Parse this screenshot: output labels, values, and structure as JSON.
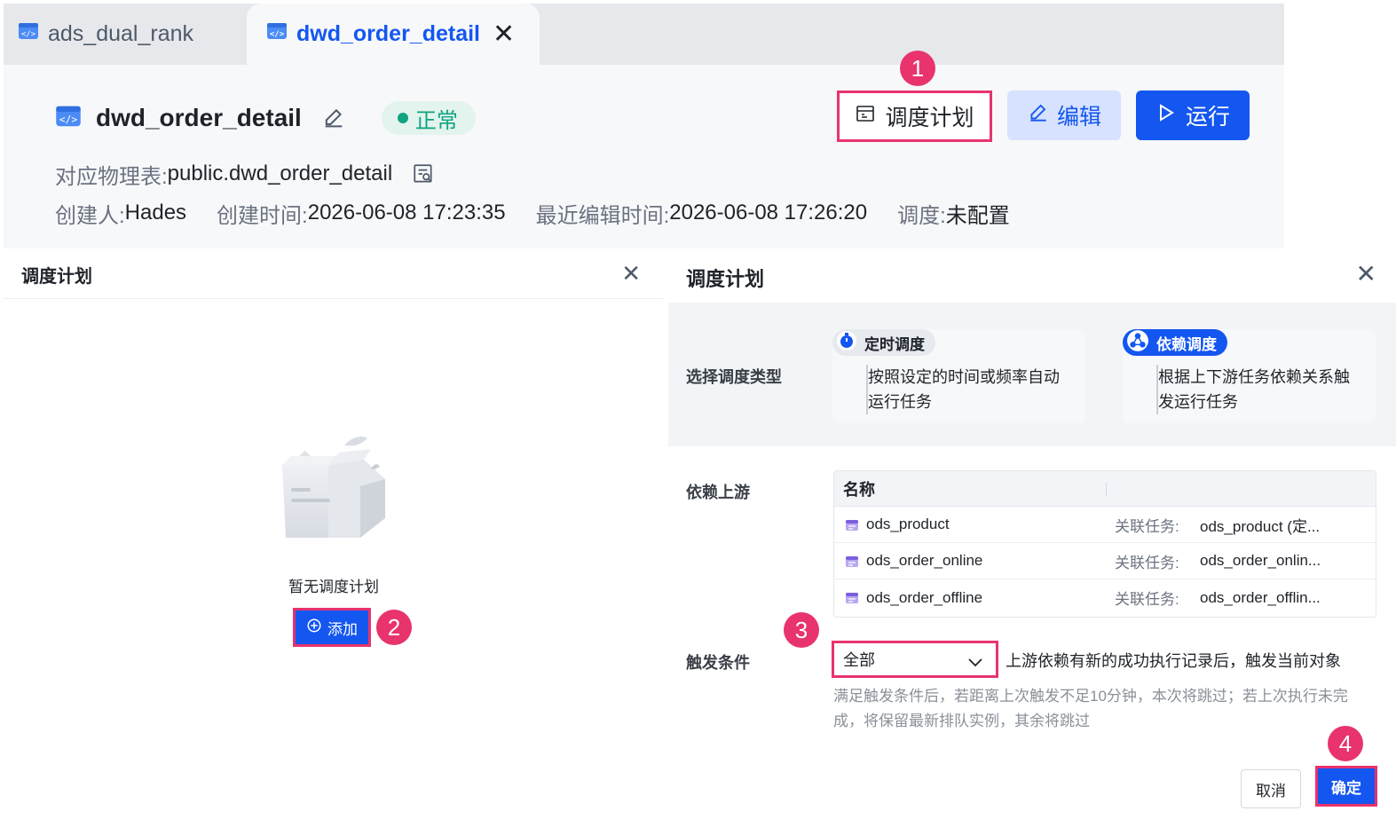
{
  "tabs": [
    {
      "label": "ads_dual_rank",
      "active": false
    },
    {
      "label": "dwd_order_detail",
      "active": true
    }
  ],
  "header": {
    "title": "dwd_order_detail",
    "status": "正常",
    "physical_table_label": "对应物理表:",
    "physical_table_value": "public.dwd_order_detail",
    "creator_label": "创建人:",
    "creator_value": "Hades",
    "created_time_label": "创建时间:",
    "created_time_value": "2026-06-08 17:23:35",
    "edited_time_label": "最近编辑时间:",
    "edited_time_value": "2026-06-08 17:26:20",
    "schedule_label": "调度:",
    "schedule_value": "未配置"
  },
  "toolbar": {
    "schedule_label": "调度计划",
    "edit_label": "编辑",
    "run_label": "运行"
  },
  "steps": [
    "1",
    "2",
    "3",
    "4"
  ],
  "left_dialog": {
    "title": "调度计划",
    "empty_text": "暂无调度计划",
    "add_label": "添加"
  },
  "right_dialog": {
    "title": "调度计划",
    "type_label": "选择调度类型",
    "timer_type": {
      "title": "定时调度",
      "desc_line1": "按照设定的时间或频率自动",
      "desc_line2": "运行任务"
    },
    "dep_type": {
      "title": "依赖调度",
      "desc_line1": "根据上下游任务依赖关系触",
      "desc_line2": "发运行任务"
    },
    "upstream_label": "依赖上游",
    "upstream_header": "名称",
    "upstream_rows": [
      {
        "name": "ods_product",
        "rel_label": "关联任务:",
        "rel_value": "ods_product (定..."
      },
      {
        "name": "ods_order_online",
        "rel_label": "关联任务:",
        "rel_value": "ods_order_onlin..."
      },
      {
        "name": "ods_order_offline",
        "rel_label": "关联任务:",
        "rel_value": "ods_order_offlin..."
      }
    ],
    "trigger_label": "触发条件",
    "trigger_value": "全部",
    "trigger_desc": "上游依赖有新的成功执行记录后，触发当前对象",
    "trigger_hint": "满足触发条件后，若距离上次触发不足10分钟，本次将跳过；若上次执行未完成，将保留最新排队实例，其余将跳过",
    "cancel_label": "取消",
    "ok_label": "确定"
  },
  "colors": {
    "primary": "#1456f0",
    "highlight": "#e8336d",
    "success": "#11a37f"
  }
}
